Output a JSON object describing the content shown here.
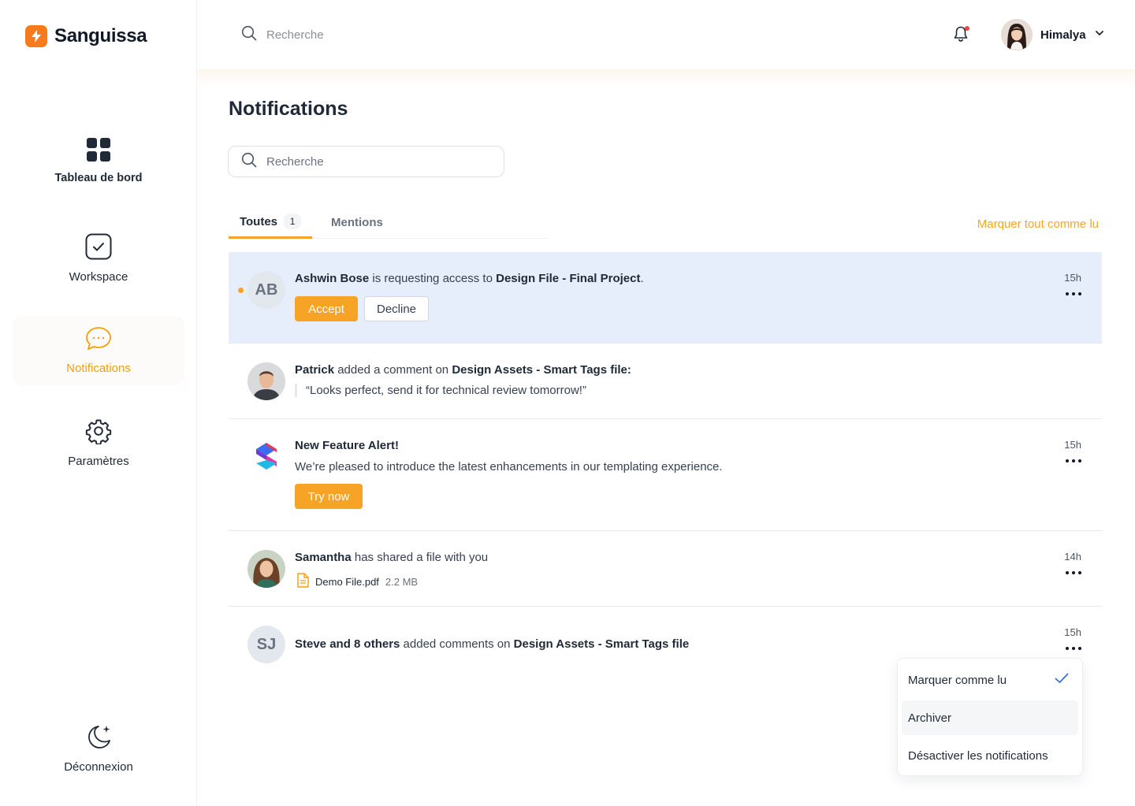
{
  "brand": {
    "name": "Sanguissa",
    "accent": "#f77b1d"
  },
  "sidebar": {
    "items": [
      {
        "label": "Tableau de bord",
        "icon": "grid-icon"
      },
      {
        "label": "Workspace",
        "icon": "check-square-icon"
      },
      {
        "label": "Notifications",
        "icon": "chat-bubble-icon",
        "active": true
      },
      {
        "label": "Paramètres",
        "icon": "gear-icon"
      }
    ],
    "logout": {
      "label": "Déconnexion",
      "icon": "moon-sparkle-icon"
    }
  },
  "topbar": {
    "search_placeholder": "Recherche",
    "user_name": "Himalya"
  },
  "main": {
    "title": "Notifications",
    "search_placeholder": "Recherche",
    "tabs": [
      {
        "label": "Toutes",
        "badge": "1"
      },
      {
        "label": "Mentions"
      }
    ],
    "mark_all_label": "Marquer tout comme lu"
  },
  "notifications": [
    {
      "initials": "AB",
      "actor": "Ashwin Bose",
      "text": " is requesting access to ",
      "target": "Design File - Final Project",
      "suffix": ".",
      "time": "15h",
      "accept_label": "Accept",
      "decline_label": "Decline"
    },
    {
      "actor": "Patrick",
      "text": " added a comment on ",
      "target": "Design Assets - Smart Tags file:",
      "quote": "“Looks perfect, send it for technical review tomorrow!”"
    },
    {
      "title": "New Feature Alert!",
      "body": "We’re pleased to introduce the latest enhancements in our templating experience.",
      "time": "15h",
      "cta_label": "Try now"
    },
    {
      "actor": "Samantha",
      "text": " has shared a file with you",
      "file_name": "Demo File.pdf",
      "file_size": "2.2 MB",
      "time": "14h"
    },
    {
      "initials": "SJ",
      "actor": "Steve and 8 others",
      "text": " added comments on ",
      "target": "Design Assets - Smart Tags file",
      "time": "15h"
    }
  ],
  "dropdown": {
    "items": [
      {
        "label": "Marquer comme lu",
        "checked": true
      },
      {
        "label": "Archiver"
      },
      {
        "label": "Désactiver les notifications"
      }
    ]
  },
  "colors": {
    "accent": "#f7a325",
    "highlight": "#e7eefb",
    "unread": "#f7a325",
    "bell_dot": "#ef4444"
  }
}
